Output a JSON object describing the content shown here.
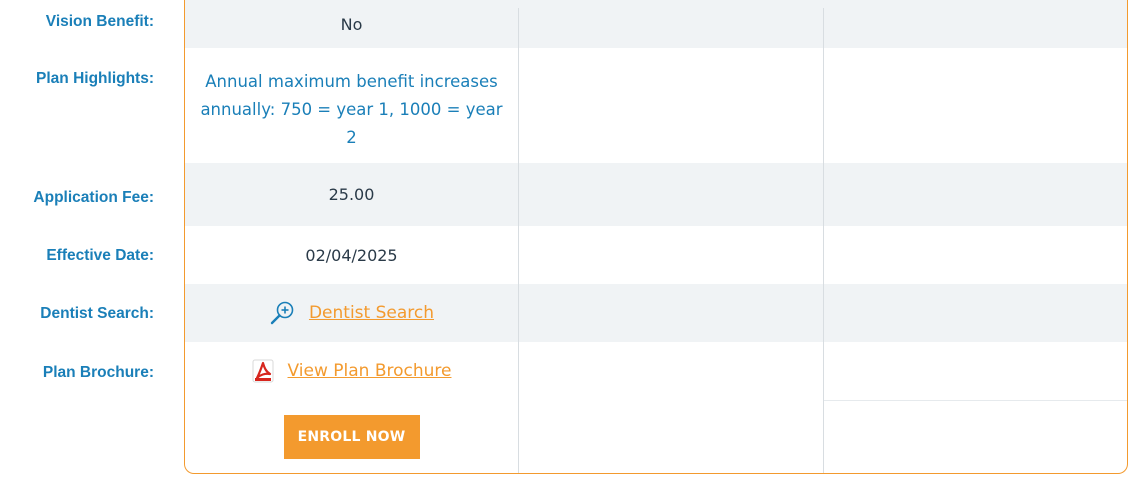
{
  "rows": [
    {
      "label": "Vision Benefit:",
      "value": "No"
    },
    {
      "label": "Plan Highlights:",
      "value": "Annual maximum benefit increases annually: 750 = year 1, 1000 = year 2"
    },
    {
      "label": "Application Fee:",
      "value": "25.00"
    },
    {
      "label": "Effective Date:",
      "value": "02/04/2025"
    },
    {
      "label": "Dentist Search:",
      "value": "Dentist Search"
    },
    {
      "label": "Plan Brochure:",
      "value": "View Plan Brochure"
    }
  ],
  "enroll_label": "ENROLL NOW",
  "icons": {
    "dentist_search": "zoom-in-icon",
    "plan_brochure": "pdf-icon"
  },
  "colors": {
    "accent": "#f39a2e",
    "label_blue": "#1a7fb8",
    "row_shade": "#f0f3f5"
  }
}
